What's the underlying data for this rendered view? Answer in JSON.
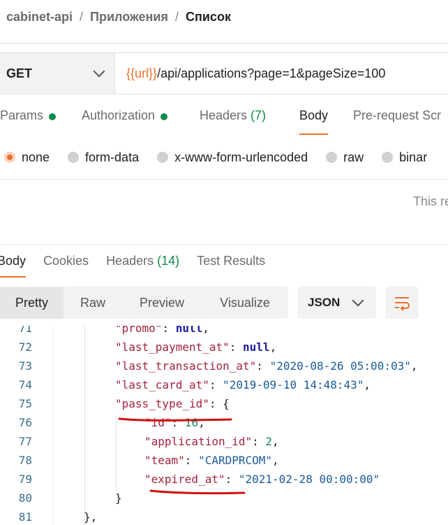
{
  "breadcrumb": {
    "items": [
      "cabinet-api",
      "Приложения"
    ],
    "separator": "/",
    "current": "Список"
  },
  "request": {
    "method": "GET",
    "url_variable": "{{url}}",
    "url_path": "/api/applications?page=1&pageSize=100"
  },
  "request_tabs": [
    {
      "label": "Params",
      "dot": true
    },
    {
      "label": "Authorization",
      "dot": true
    },
    {
      "label": "Headers",
      "count": "(7)"
    },
    {
      "label": "Body",
      "active": true
    },
    {
      "label": "Pre-request Scr"
    }
  ],
  "body_types": [
    {
      "label": "none",
      "selected": true
    },
    {
      "label": "form-data"
    },
    {
      "label": "x-www-form-urlencoded"
    },
    {
      "label": "raw"
    },
    {
      "label": "binar"
    }
  ],
  "body_note": "This re",
  "response_tabs": [
    {
      "label": "Body",
      "active": true
    },
    {
      "label": "Cookies"
    },
    {
      "label": "Headers",
      "count": "(14)"
    },
    {
      "label": "Test Results"
    }
  ],
  "view_modes": [
    "Pretty",
    "Raw",
    "Preview",
    "Visualize"
  ],
  "active_view": "Pretty",
  "format": "JSON",
  "code_lines": [
    {
      "num": "71",
      "indent": 1,
      "tokens": [
        [
          "k",
          "\"promo\""
        ],
        [
          "p",
          ": "
        ],
        [
          "n",
          "null"
        ],
        [
          "p",
          ","
        ]
      ]
    },
    {
      "num": "72",
      "indent": 1,
      "tokens": [
        [
          "k",
          "\"last_payment_at\""
        ],
        [
          "p",
          ": "
        ],
        [
          "n",
          "null"
        ],
        [
          "p",
          ","
        ]
      ]
    },
    {
      "num": "73",
      "indent": 1,
      "tokens": [
        [
          "k",
          "\"last_transaction_at\""
        ],
        [
          "p",
          ": "
        ],
        [
          "s",
          "\"2020-08-26 05:00:03\""
        ],
        [
          "p",
          ","
        ]
      ]
    },
    {
      "num": "74",
      "indent": 1,
      "tokens": [
        [
          "k",
          "\"last_card_at\""
        ],
        [
          "p",
          ": "
        ],
        [
          "s",
          "\"2019-09-10 14:48:43\""
        ],
        [
          "p",
          ","
        ]
      ]
    },
    {
      "num": "75",
      "indent": 1,
      "tokens": [
        [
          "k",
          "\"pass_type_id\""
        ],
        [
          "p",
          ": {"
        ]
      ]
    },
    {
      "num": "76",
      "indent": 2,
      "tokens": [
        [
          "k",
          "\"id\""
        ],
        [
          "p",
          ": "
        ],
        [
          "num",
          "16"
        ],
        [
          "p",
          ","
        ]
      ]
    },
    {
      "num": "77",
      "indent": 2,
      "tokens": [
        [
          "k",
          "\"application_id\""
        ],
        [
          "p",
          ": "
        ],
        [
          "num",
          "2"
        ],
        [
          "p",
          ","
        ]
      ]
    },
    {
      "num": "78",
      "indent": 2,
      "tokens": [
        [
          "k",
          "\"team\""
        ],
        [
          "p",
          ": "
        ],
        [
          "s",
          "\"CARDPRCOM\""
        ],
        [
          "p",
          ","
        ]
      ]
    },
    {
      "num": "79",
      "indent": 2,
      "tokens": [
        [
          "k",
          "\"expired_at\""
        ],
        [
          "p",
          ": "
        ],
        [
          "s",
          "\"2021-02-28 00:00:00\""
        ]
      ]
    },
    {
      "num": "80",
      "indent": 1,
      "tokens": [
        [
          "p",
          "}"
        ]
      ]
    },
    {
      "num": "81",
      "indent": 0,
      "tokens": [
        [
          "p",
          "},"
        ]
      ]
    }
  ],
  "colors": {
    "accent": "#e8702a",
    "status_green": "#0d8a4c",
    "annotation_red": "#d01010"
  }
}
